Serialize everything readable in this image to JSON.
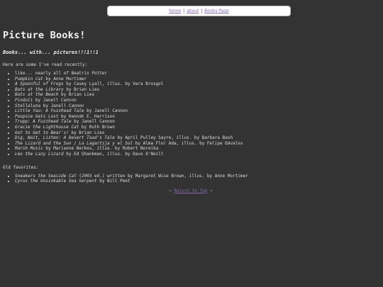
{
  "nav": {
    "home": "home",
    "about": "about",
    "books": "Books Page",
    "separator": "|"
  },
  "page": {
    "title": "Picture Books!",
    "subtitle": "Books... with... pictures!!!1!!1",
    "intro": "Here are some I've read recently:",
    "old_favorites_label": "Old favorites:",
    "return_prefix": "~ ",
    "return_link": "Return to Top",
    "return_suffix": " ~"
  },
  "recent_books": [
    {
      "title": "",
      "rest": "like... nearly all of Beatrix Potter"
    },
    {
      "title": "Pumpkin Cat",
      "rest": " by Anne Mortimer"
    },
    {
      "title": "A Spoonful of Frogs",
      "rest": " by Casey Lyall, illus. by Vera Brosgol"
    },
    {
      "title": "Bats at the Library",
      "rest": " by Brian Lies"
    },
    {
      "title": "Bats at the Beach",
      "rest": " by Brian Lies"
    },
    {
      "title": "Pinduli",
      "rest": " by Janell Cannon"
    },
    {
      "title": "Stellaluna",
      "rest": " by Janell Cannon"
    },
    {
      "title": "Little Yau: A Fuzzhead Tale",
      "rest": " by Janell Cannon"
    },
    {
      "title": "Poopsie Gets Lost",
      "rest": " by Hannah E. Harrison"
    },
    {
      "title": "Trupp: A Fuzzhead Tale",
      "rest": " by Janell Cannon"
    },
    {
      "title": "Gracie the Lighthouse Cat",
      "rest": " by Ruth Brown"
    },
    {
      "title": "Got to Get to Bear's!",
      "rest": " by Brian Lies"
    },
    {
      "title": "Dig, Wait, Listen: A Desert Toad's Tale",
      "rest": " by April Pulley Sayre, illus. by Barbara Bash"
    },
    {
      "title": "The Lizard and the Sun / La Lagartija y el Sol",
      "rest": " by Alma Flor Ada, illus. by Felipe Dávalos"
    },
    {
      "title": "Marsh Music",
      "rest": " by Marianne Berkes, illus. by Robert Noreika"
    },
    {
      "title": "Leo the Lazy Lizard",
      "rest": " by Ed Shankman, illus. by Dave O'Neill"
    }
  ],
  "old_favorites": [
    {
      "title": "Sneakers the Seaside Cat",
      "rest": " (2003 ed.) written by Margaret Wise Brown, illus. by Anne Mortimer"
    },
    {
      "title": "Cyrus the Unsinkable Sea Serpent",
      "rest": " by Bill Peet"
    }
  ],
  "colors": {
    "background": "#333333",
    "link": "#8a6bb1",
    "navbar_bg": "#ffffff"
  }
}
